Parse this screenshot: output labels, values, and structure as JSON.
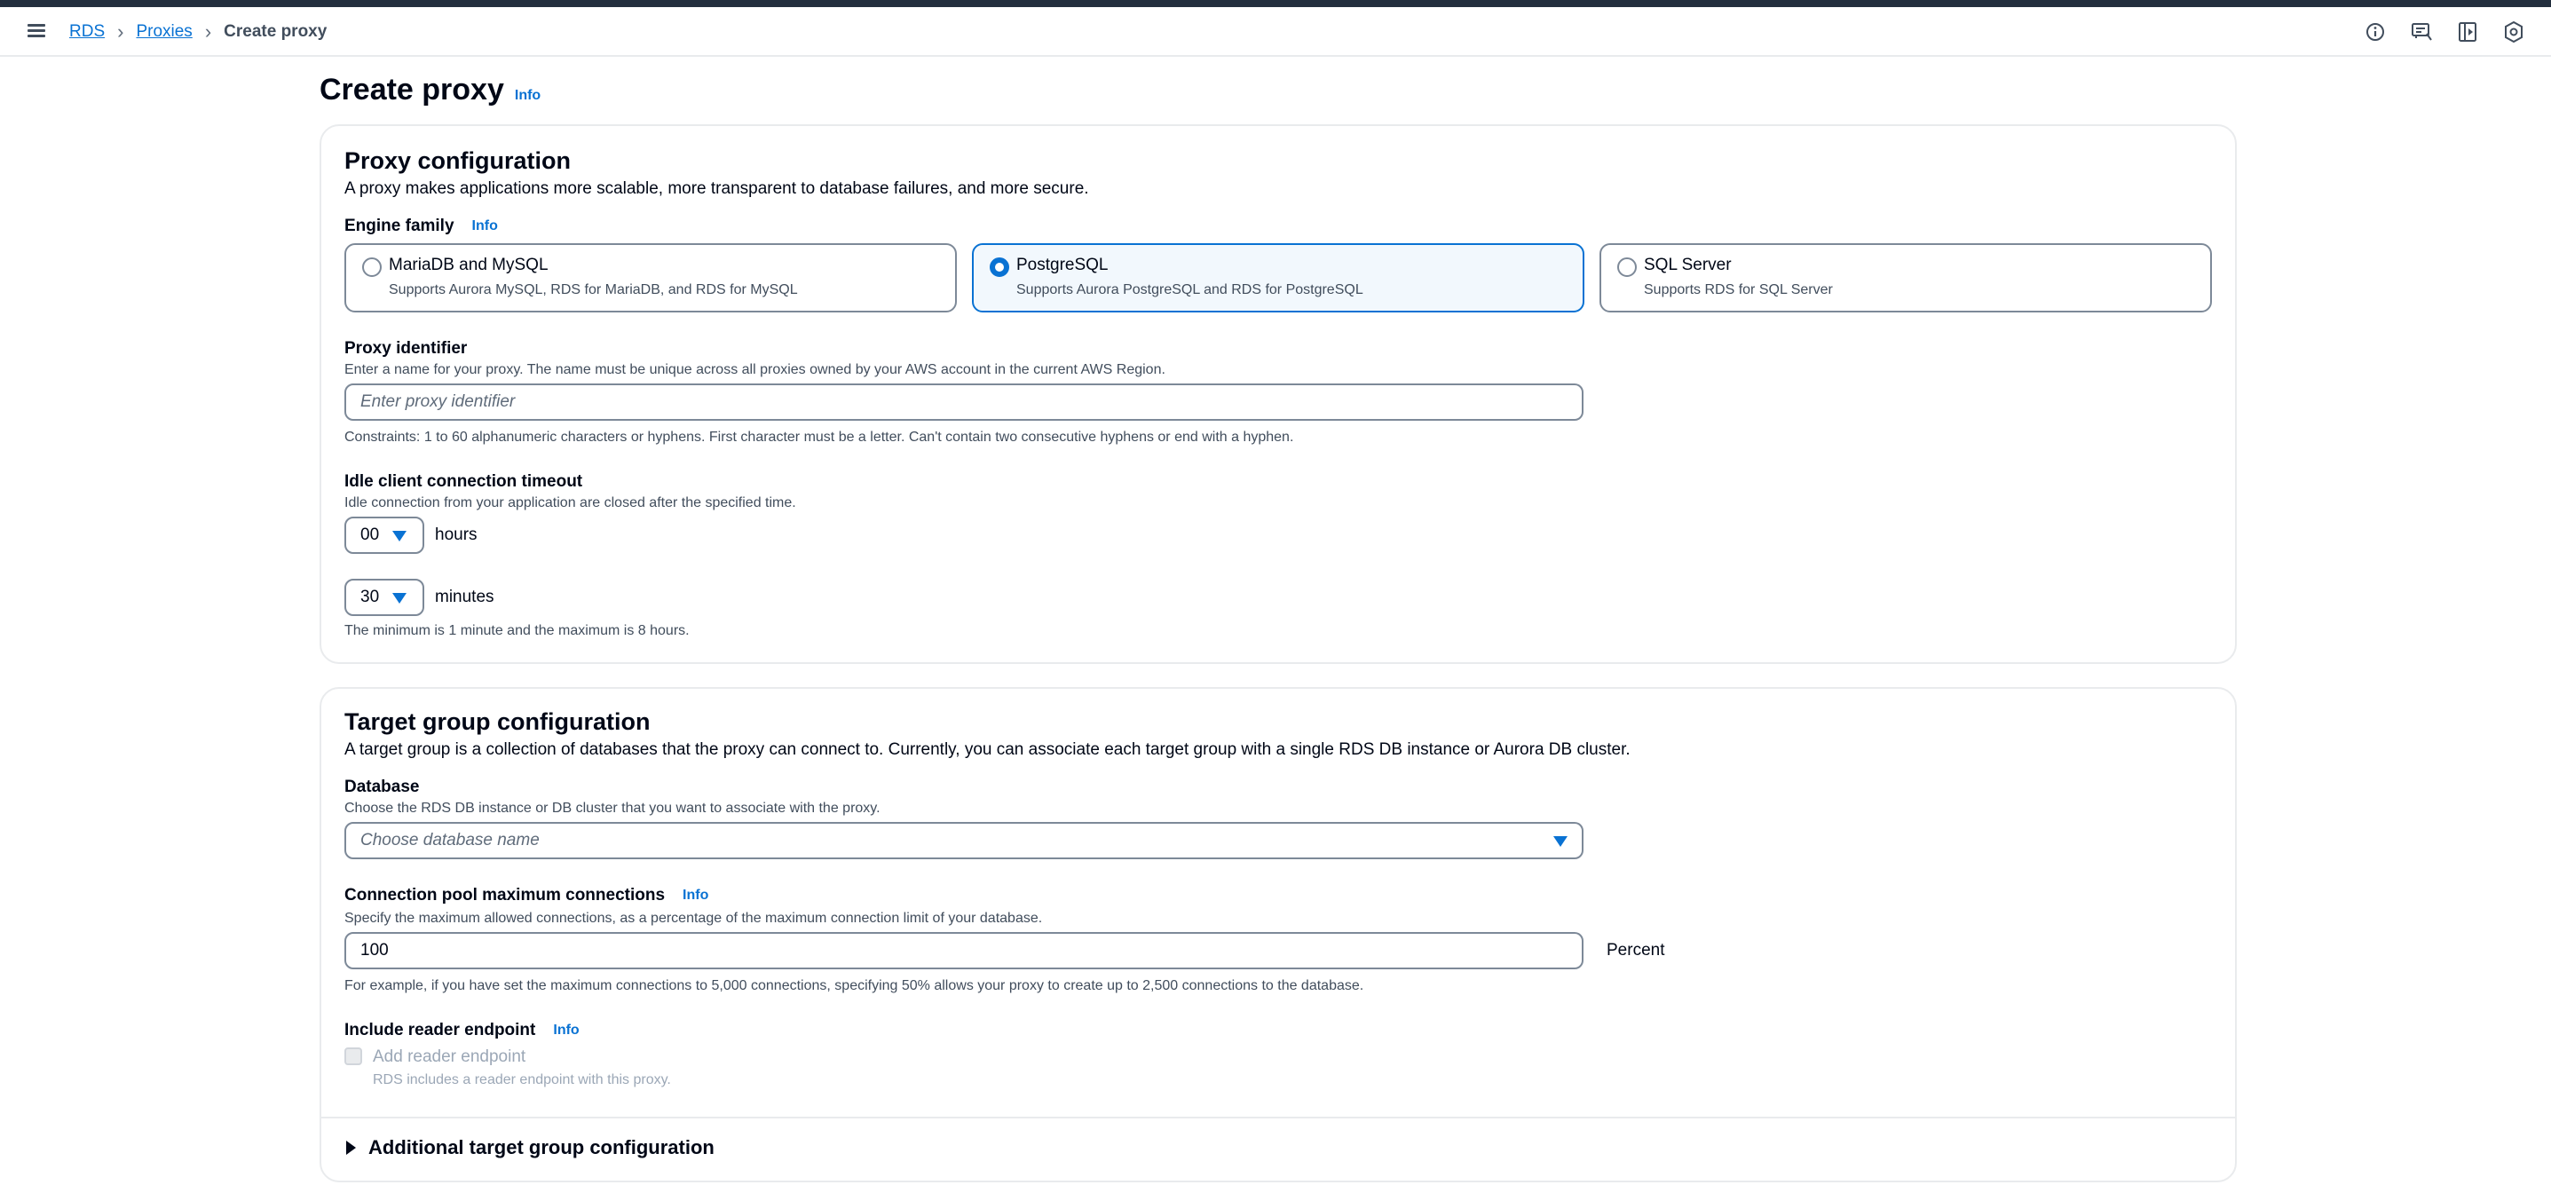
{
  "breadcrumb": {
    "items": [
      "RDS",
      "Proxies"
    ],
    "current": "Create proxy"
  },
  "page": {
    "title": "Create proxy",
    "info": "Info"
  },
  "proxy_config": {
    "heading": "Proxy configuration",
    "description": "A proxy makes applications more scalable, more transparent to database failures, and more secure.",
    "engine_family": {
      "label": "Engine family",
      "info": "Info",
      "options": [
        {
          "title": "MariaDB and MySQL",
          "subtitle": "Supports Aurora MySQL, RDS for MariaDB, and RDS for MySQL",
          "selected": false
        },
        {
          "title": "PostgreSQL",
          "subtitle": "Supports Aurora PostgreSQL and RDS for PostgreSQL",
          "selected": true
        },
        {
          "title": "SQL Server",
          "subtitle": "Supports RDS for SQL Server",
          "selected": false
        }
      ]
    },
    "proxy_identifier": {
      "label": "Proxy identifier",
      "description": "Enter a name for your proxy. The name must be unique across all proxies owned by your AWS account in the current AWS Region.",
      "value": "",
      "placeholder": "Enter proxy identifier",
      "constraint": "Constraints: 1 to 60 alphanumeric characters or hyphens. First character must be a letter. Can't contain two consecutive hyphens or end with a hyphen."
    },
    "idle_timeout": {
      "label": "Idle client connection timeout",
      "description": "Idle connection from your application are closed after the specified time.",
      "hours_value": "00",
      "hours_unit": "hours",
      "minutes_value": "30",
      "minutes_unit": "minutes",
      "constraint": "The minimum is 1 minute and the maximum is 8 hours."
    }
  },
  "target_group": {
    "heading": "Target group configuration",
    "description": "A target group is a collection of databases that the proxy can connect to. Currently, you can associate each target group with a single RDS DB instance or Aurora DB cluster.",
    "database": {
      "label": "Database",
      "description": "Choose the RDS DB instance or DB cluster that you want to associate with the proxy.",
      "placeholder": "Choose database name"
    },
    "pool": {
      "label": "Connection pool maximum connections",
      "info": "Info",
      "description": "Specify the maximum allowed connections, as a percentage of the maximum connection limit of your database.",
      "value": "100",
      "unit": "Percent",
      "hint": "For example, if you have set the maximum connections to 5,000 connections, specifying 50% allows your proxy to create up to 2,500 connections to the database."
    },
    "reader_endpoint": {
      "label": "Include reader endpoint",
      "info": "Info",
      "checkbox_label": "Add reader endpoint",
      "checkbox_description": "RDS includes a reader endpoint with this proxy.",
      "checked": false
    },
    "additional": "Additional target group configuration"
  },
  "colors": {
    "accent": "#0972d3",
    "header_strip": "#232f3e",
    "border": "#7d8998",
    "selected_bg": "#f2f8fd"
  }
}
